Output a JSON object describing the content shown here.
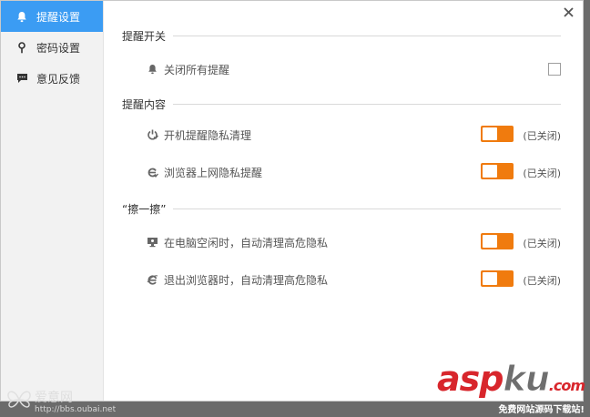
{
  "sidebar": {
    "items": [
      {
        "label": "提醒设置",
        "icon": "bell-icon",
        "active": true
      },
      {
        "label": "密码设置",
        "icon": "key-icon",
        "active": false
      },
      {
        "label": "意见反馈",
        "icon": "chat-icon",
        "active": false
      }
    ]
  },
  "sections": {
    "switch": {
      "title": "提醒开关",
      "rows": [
        {
          "label": "关闭所有提醒",
          "icon": "bell-icon",
          "checked": false
        }
      ]
    },
    "content": {
      "title": "提醒内容",
      "rows": [
        {
          "label": "开机提醒隐私清理",
          "icon": "power-icon",
          "status": "(已关闭)"
        },
        {
          "label": "浏览器上网隐私提醒",
          "icon": "browser-icon",
          "status": "(已关闭)"
        }
      ]
    },
    "wipe": {
      "title": "“擦一擦”",
      "rows": [
        {
          "label": "在电脑空闲时，自动清理高危隐私",
          "icon": "monitor-icon",
          "status": "(已关闭)"
        },
        {
          "label": "退出浏览器时，自动清理高危隐私",
          "icon": "ie-icon",
          "status": "(已关闭)"
        }
      ]
    }
  },
  "watermark": {
    "left_script": "爱意网",
    "left_url": "http://bbs.oubai.net",
    "brand_red": "asp",
    "brand_grey": "ku",
    "brand_domain": ".com",
    "tagline": "免费网站源码下载站!"
  },
  "colors": {
    "accent": "#3b9cf3",
    "toggle": "#f07b0e"
  }
}
